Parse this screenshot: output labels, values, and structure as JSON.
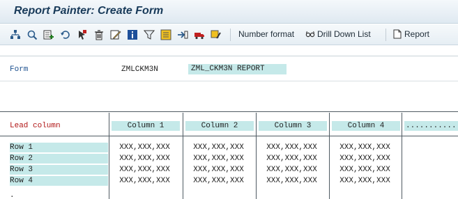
{
  "window": {
    "title": "Report Painter: Create Form"
  },
  "toolbar": {
    "icons": [
      "tree-icon",
      "search-icon",
      "add-row-icon",
      "undo-icon",
      "select-icon",
      "delete-icon",
      "edit-icon",
      "info-icon",
      "filter-icon",
      "settings-icon",
      "transport-icon",
      "truck-icon",
      "highlight-icon"
    ],
    "number_format": "Number format",
    "drill_down": "Drill Down List",
    "report": "Report"
  },
  "form": {
    "label": "Form",
    "code": "ZMLCKM3N",
    "description": "ZML_CKM3N REPORT"
  },
  "grid": {
    "lead_column": "Lead column",
    "columns": [
      "Column 1",
      "Column 2",
      "Column 3",
      "Column 4",
      "..........."
    ],
    "rows": [
      {
        "label": "Row 1",
        "cells": [
          "XXX,XXX,XXX",
          "XXX,XXX,XXX",
          "XXX,XXX,XXX",
          "XXX,XXX,XXX"
        ]
      },
      {
        "label": "Row 2",
        "cells": [
          "XXX,XXX,XXX",
          "XXX,XXX,XXX",
          "XXX,XXX,XXX",
          "XXX,XXX,XXX"
        ]
      },
      {
        "label": "Row 3",
        "cells": [
          "XXX,XXX,XXX",
          "XXX,XXX,XXX",
          "XXX,XXX,XXX",
          "XXX,XXX,XXX"
        ]
      },
      {
        "label": "Row 4",
        "cells": [
          "XXX,XXX,XXX",
          "XXX,XXX,XXX",
          "XXX,XXX,XXX",
          "XXX,XXX,XXX"
        ]
      }
    ],
    "trailing_row": "."
  },
  "colors": {
    "header_bg": "#c5e9e9",
    "lead_text": "#b01515",
    "form_label_text": "#1b4f8e"
  }
}
